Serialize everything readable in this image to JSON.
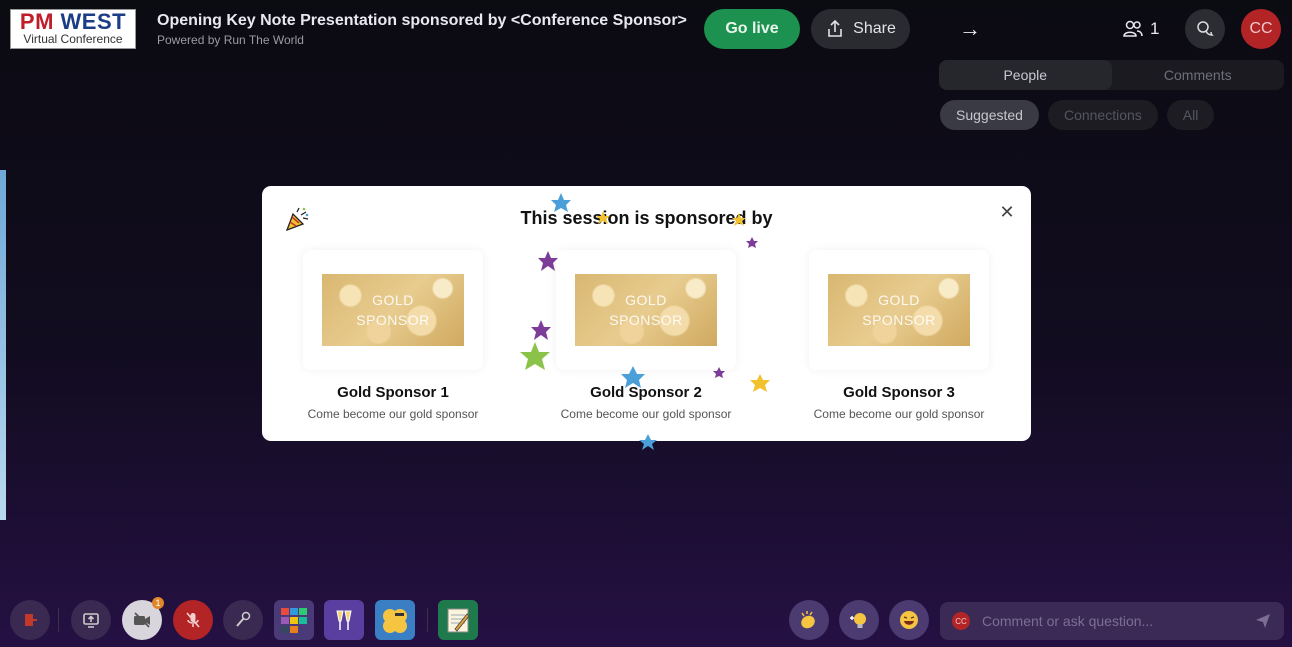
{
  "header": {
    "logo_top_pm": "PM",
    "logo_top_west": "WEST",
    "logo_bottom": "Virtual Conference",
    "title": "Opening Key Note Presentation sponsored by <Conference Sponsor>",
    "powered_by": "Powered by Run The World",
    "go_live_label": "Go live",
    "share_label": "Share",
    "attendee_count": "1",
    "avatar_initials": "CC"
  },
  "panel": {
    "tabs": [
      "People",
      "Comments"
    ],
    "active_tab": "People",
    "filters": [
      "Suggested",
      "Connections",
      "All"
    ],
    "active_filter": "Suggested"
  },
  "modal": {
    "title": "This session is sponsored by",
    "sponsors": [
      {
        "image_text_1": "GOLD",
        "image_text_2": "SPONSOR",
        "name": "Gold Sponsor 1",
        "description": "Come become our gold sponsor"
      },
      {
        "image_text_1": "GOLD",
        "image_text_2": "SPONSOR",
        "name": "Gold Sponsor 2",
        "description": "Come become our gold sponsor"
      },
      {
        "image_text_1": "GOLD",
        "image_text_2": "SPONSOR",
        "name": "Gold Sponsor 3",
        "description": "Come become our gold sponsor"
      }
    ]
  },
  "bottom": {
    "video_badge": "1",
    "comment_avatar": "CC",
    "comment_placeholder": "Comment or ask question..."
  },
  "colors": {
    "go_live": "#1d9150",
    "avatar": "#b32427",
    "background_bottom": "#251043",
    "confetti": [
      "#7d3c98",
      "#4a9fd8",
      "#f2c12e",
      "#8bc34a"
    ]
  },
  "icons": [
    "party-popper-icon",
    "close-icon",
    "share-icon",
    "arrow-right-icon",
    "people-icon",
    "chat-icon",
    "leave-icon",
    "screen-share-icon",
    "video-off-icon",
    "mic-off-icon",
    "microphone-icon",
    "apps-icon",
    "cheers-icon",
    "emoji-icon",
    "notepad-icon",
    "clap-icon",
    "idea-icon",
    "laugh-icon",
    "send-icon"
  ]
}
